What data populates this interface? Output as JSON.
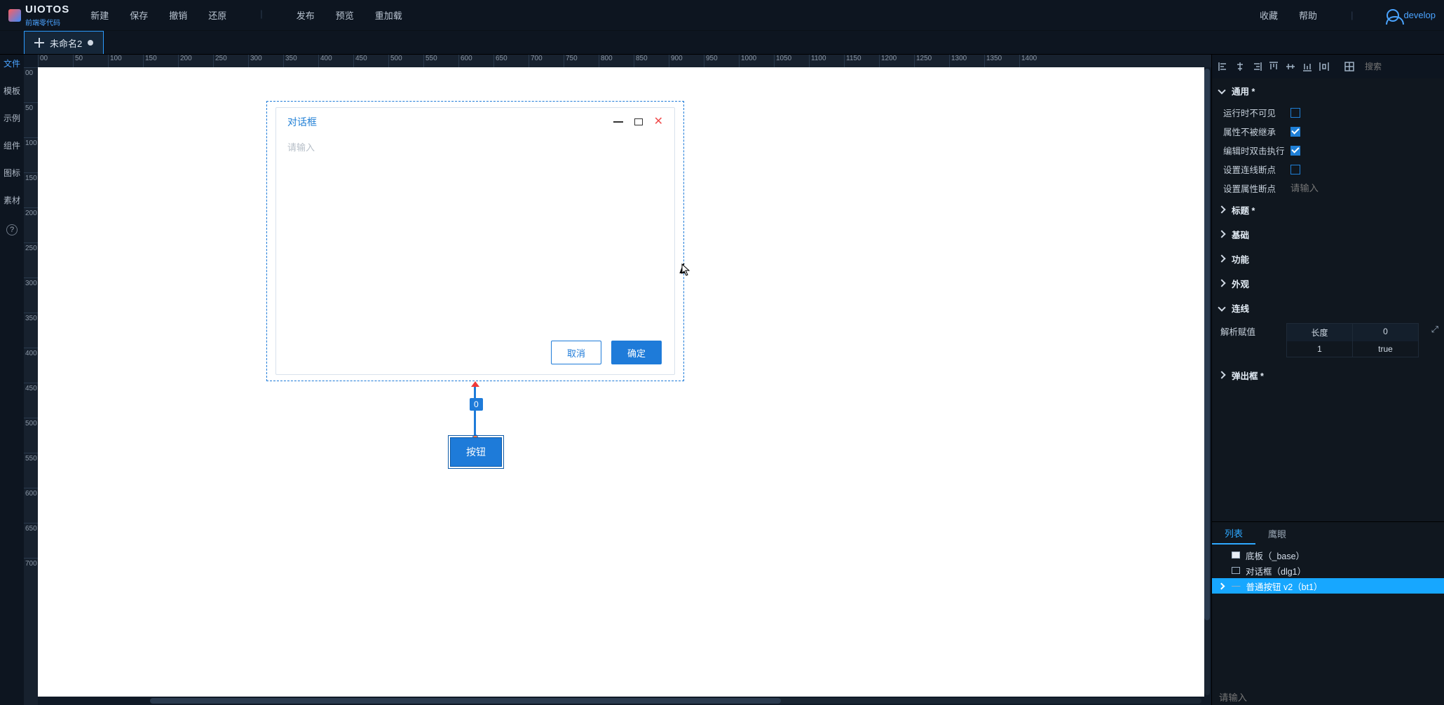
{
  "brand": {
    "name": "UIOTOS",
    "sub": "前端零代码"
  },
  "topmenu": {
    "new": "新建",
    "save": "保存",
    "undo": "撤销",
    "redo": "还原",
    "publish": "发布",
    "preview": "预览",
    "reload": "重加载",
    "favorite": "收藏",
    "help": "帮助"
  },
  "user": "develop",
  "doc_tab": {
    "title": "未命名2"
  },
  "leftbar": {
    "file": "文件",
    "tpl": "模板",
    "demo": "示例",
    "comp": "组件",
    "icon": "图标",
    "asset": "素材"
  },
  "ruler_h": [
    "00",
    "50",
    "100",
    "150",
    "200",
    "250",
    "300",
    "350",
    "400",
    "450",
    "500",
    "550",
    "600",
    "650",
    "700",
    "750",
    "800",
    "850",
    "900",
    "950",
    "1000",
    "1050",
    "1100",
    "1150",
    "1200",
    "1250",
    "1300",
    "1350",
    "1400"
  ],
  "ruler_v": [
    "00",
    "50",
    "100",
    "150",
    "200",
    "250",
    "300",
    "350",
    "400",
    "450",
    "500",
    "550",
    "600",
    "650",
    "700"
  ],
  "dialog": {
    "title": "对话框",
    "placeholder": "请输入",
    "cancel": "取消",
    "ok": "确定"
  },
  "connector": {
    "badge": "0"
  },
  "canvas_button": "按钮",
  "rp": {
    "search_ph": "搜索",
    "sec_common": "通用 *",
    "p_hidden": "运行时不可见",
    "p_noinherit": "属性不被继承",
    "p_dblclick": "编辑时双击执行",
    "p_linebreak": "设置连线断点",
    "p_attrbreak": "设置属性断点",
    "p_attrbreak_ph": "请输入",
    "sec_title": "标题 *",
    "sec_base": "基础",
    "sec_func": "功能",
    "sec_look": "外观",
    "sec_link": "连线",
    "parse_label": "解析赋值",
    "link_head1": "长度",
    "link_head2": "0",
    "link_v1": "1",
    "link_v2": "true",
    "sec_popup": "弹出框 *"
  },
  "outline": {
    "tab_list": "列表",
    "tab_eye": "鹰眼",
    "n0": "底板（_base）",
    "n1": "对话框（dlg1）",
    "n2": "普通按钮 v2（bt1）",
    "footer_ph": "请输入"
  }
}
